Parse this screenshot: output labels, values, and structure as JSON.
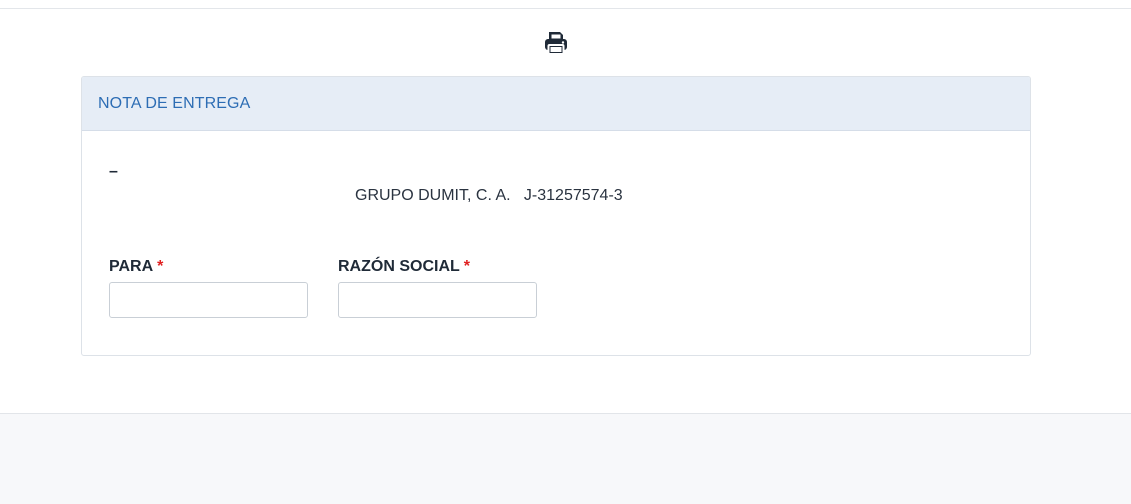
{
  "toolbar": {
    "print_icon": "print-icon"
  },
  "card": {
    "header_title": "NOTA DE ENTREGA",
    "dash": "–",
    "company_name": "GRUPO DUMIT, C. A.",
    "company_rif": "J-31257574-3"
  },
  "form": {
    "para": {
      "label": "PARA",
      "required_mark": "*",
      "value": "",
      "placeholder": ""
    },
    "razon_social": {
      "label": "RAZÓN SOCIAL",
      "required_mark": "*",
      "value": "",
      "placeholder": ""
    }
  },
  "colors": {
    "header_bg": "#e6edf6",
    "header_text": "#2d6db4",
    "required": "#e02020",
    "page_bg": "#f7f8fa"
  }
}
